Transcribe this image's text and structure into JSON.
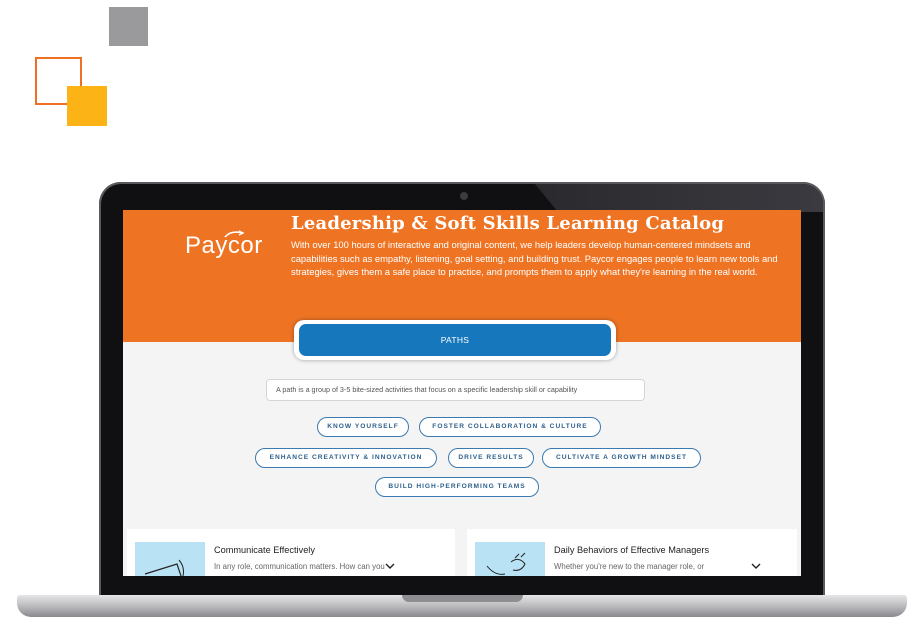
{
  "brand": {
    "logo_text": "Paycor",
    "orange": "#ee7424",
    "blue": "#1677bd",
    "yellow": "#fbb316",
    "gray": "#9a9a9c"
  },
  "catalog": {
    "title": "Leadership & Soft Skills Learning Catalog",
    "description": "With over 100 hours of interactive and original content, we help leaders develop human-centered mindsets and capabilities such as empathy, listening, goal setting, and building trust. Paycor engages people to learn new tools and strategies, gives them a safe place to practice, and prompts them to apply what they're learning in the real world."
  },
  "paths": {
    "button_label": "PATHS",
    "info_text": "A path is a group of 3-5 bite-sized activities that focus on a specific leadership skill or capability"
  },
  "filters": [
    "KNOW YOURSELF",
    "FOSTER COLLABORATION & CULTURE",
    "ENHANCE CREATIVITY & INNOVATION",
    "DRIVE RESULTS",
    "CULTIVATE A GROWTH MINDSET",
    "BUILD HIGH-PERFORMING TEAMS"
  ],
  "cards": [
    {
      "title": "Communicate Effectively",
      "description": "In any role, communication matters. How can you",
      "icon": "megaphone-illustration"
    },
    {
      "title": "Daily Behaviors of Effective Managers",
      "description": "Whether you're new to the manager role, or",
      "icon": "handshake-illustration"
    }
  ]
}
